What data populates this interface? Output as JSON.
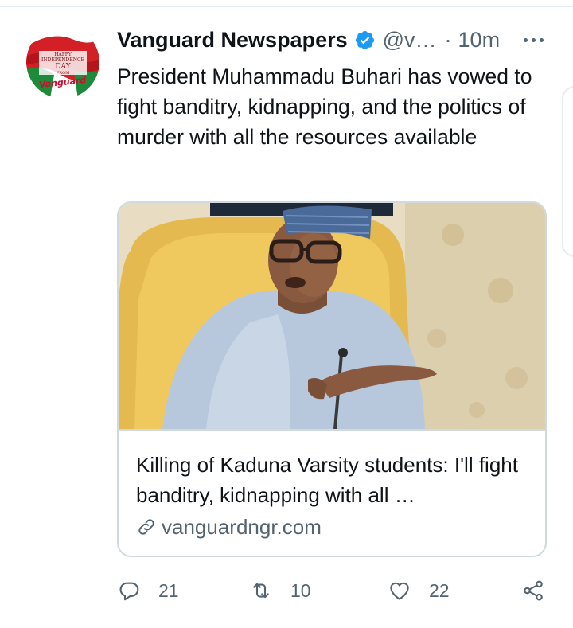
{
  "colors": {
    "text_primary": "#0f1419",
    "text_secondary": "#536471",
    "verified_blue": "#1d9bf0",
    "border": "#cfd9de"
  },
  "avatar": {
    "icon": "vanguard-independence-day-logo",
    "lines": [
      "HAPPY",
      "INDEPENDENCE",
      "DAY",
      "FROM",
      "Vanguard"
    ]
  },
  "tweet": {
    "author_name": "Vanguard Newspapers",
    "verified_icon": "verified-badge-icon",
    "handle": "@v…",
    "separator": "·",
    "timestamp": "10m",
    "more_icon": "more-options-icon",
    "text": "President Muhammadu Buhari has vowed to fight banditry, kidnapping, and the politics of murder with all the resources available"
  },
  "card": {
    "image_icon": "article-photo",
    "title": "Killing of Kaduna Varsity students: I'll fight banditry, kidnapping with all …",
    "link_icon": "link-icon",
    "domain": "vanguardngr.com"
  },
  "actions": {
    "reply": {
      "icon": "reply-icon",
      "count": "21"
    },
    "retweet": {
      "icon": "retweet-icon",
      "count": "10"
    },
    "like": {
      "icon": "heart-icon",
      "count": "22"
    },
    "share": {
      "icon": "share-icon"
    }
  }
}
